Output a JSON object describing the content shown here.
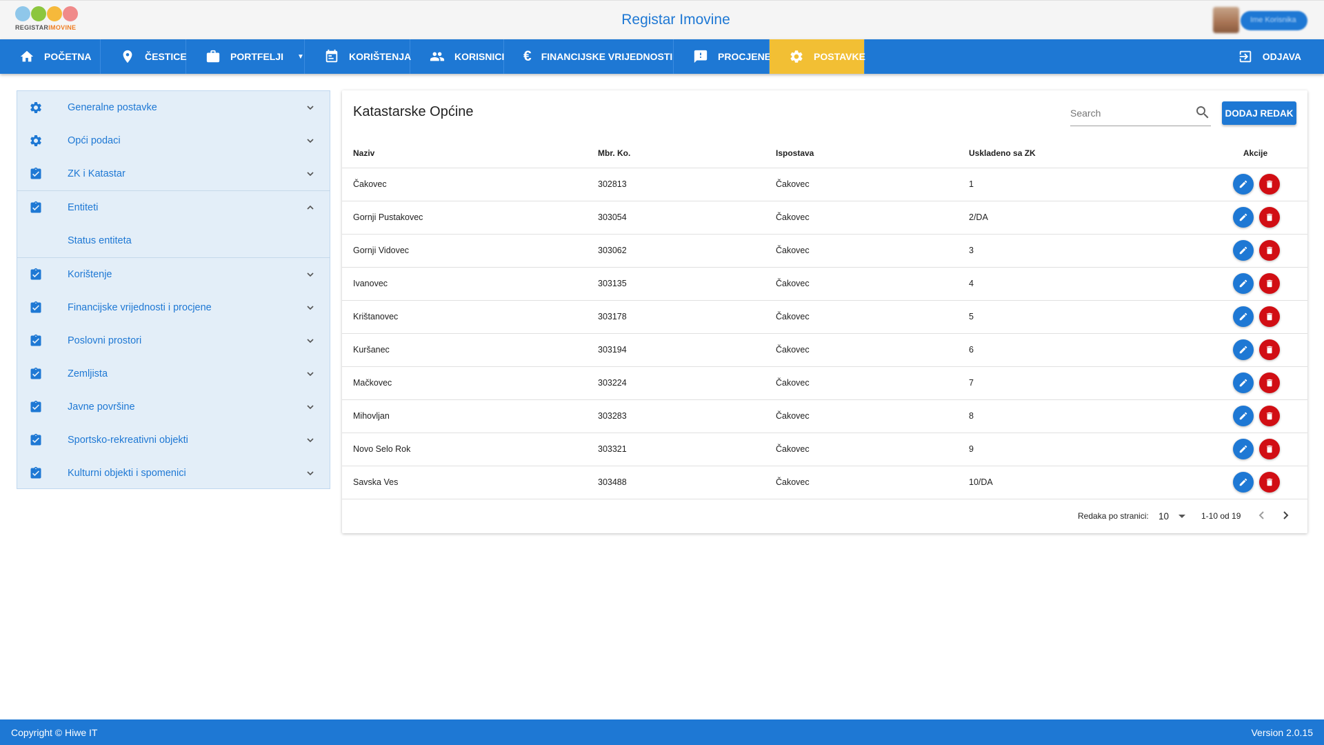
{
  "header": {
    "logo_text_main": "REGISTAR",
    "logo_text_accent": "IMOVINE",
    "app_title": "Registar Imovine",
    "user_name": "Ime Korisnika"
  },
  "nav": {
    "home": "POČETNA",
    "parcels": "ČESTICE",
    "portfolios": "PORTFELJI",
    "usages": "KORIŠTENJA",
    "users": "KORISNICI",
    "financial": "FINANCIJSKE VRIJEDNOSTI",
    "assessments": "PROCJENE",
    "settings": "POSTAVKE",
    "logout": "ODJAVA",
    "active": "settings"
  },
  "sidebar": {
    "items": [
      {
        "label": "Generalne postavke",
        "icon": "gear-icon",
        "expanded": false
      },
      {
        "label": "Opći podaci",
        "icon": "gear-icon",
        "expanded": false
      },
      {
        "label": "ZK i Katastar",
        "icon": "clipboard-check-icon",
        "expanded": false
      },
      {
        "label": "Entiteti",
        "icon": "clipboard-check-icon",
        "expanded": true,
        "sub": [
          "Status entiteta"
        ]
      },
      {
        "label": "Korištenje",
        "icon": "clipboard-check-icon",
        "expanded": false
      },
      {
        "label": "Financijske vrijednosti i procjene",
        "icon": "clipboard-check-icon",
        "expanded": false
      },
      {
        "label": "Poslovni prostori",
        "icon": "clipboard-check-icon",
        "expanded": false
      },
      {
        "label": "Zemljista",
        "icon": "clipboard-check-icon",
        "expanded": false
      },
      {
        "label": "Javne površine",
        "icon": "clipboard-check-icon",
        "expanded": false
      },
      {
        "label": "Sportsko-rekreativni objekti",
        "icon": "clipboard-check-icon",
        "expanded": false
      },
      {
        "label": "Kulturni objekti i spomenici",
        "icon": "clipboard-check-icon",
        "expanded": false
      }
    ]
  },
  "card": {
    "title": "Katastarske Općine",
    "search_placeholder": "Search",
    "add_button": "DODAJ REDAK",
    "columns": [
      "Naziv",
      "Mbr. Ko.",
      "Ispostava",
      "Uskladeno sa ZK",
      "Akcije"
    ],
    "rows": [
      [
        "Čakovec",
        "302813",
        "Čakovec",
        "1"
      ],
      [
        "Gornji Pustakovec",
        "303054",
        "Čakovec",
        "2/DA"
      ],
      [
        "Gornji Vidovec",
        "303062",
        "Čakovec",
        "3"
      ],
      [
        "Ivanovec",
        "303135",
        "Čakovec",
        "4"
      ],
      [
        "Krištanovec",
        "303178",
        "Čakovec",
        "5"
      ],
      [
        "Kuršanec",
        "303194",
        "Čakovec",
        "6"
      ],
      [
        "Mačkovec",
        "303224",
        "Čakovec",
        "7"
      ],
      [
        "Mihovljan",
        "303283",
        "Čakovec",
        "8"
      ],
      [
        "Novo Selo Rok",
        "303321",
        "Čakovec",
        "9"
      ],
      [
        "Savska Ves",
        "303488",
        "Čakovec",
        "10/DA"
      ]
    ],
    "pagination": {
      "rows_per_page_label": "Redaka po stranici:",
      "rows_per_page": "10",
      "range": "1-10 od 19"
    }
  },
  "footer": {
    "copyright": "Copyright © Hiwe IT",
    "version": "Version 2.0.15"
  },
  "colors": {
    "primary": "#1e78d4",
    "active_nav": "#f2bf34",
    "delete": "#d10e14",
    "sidebar_bg": "#e3eef8"
  }
}
